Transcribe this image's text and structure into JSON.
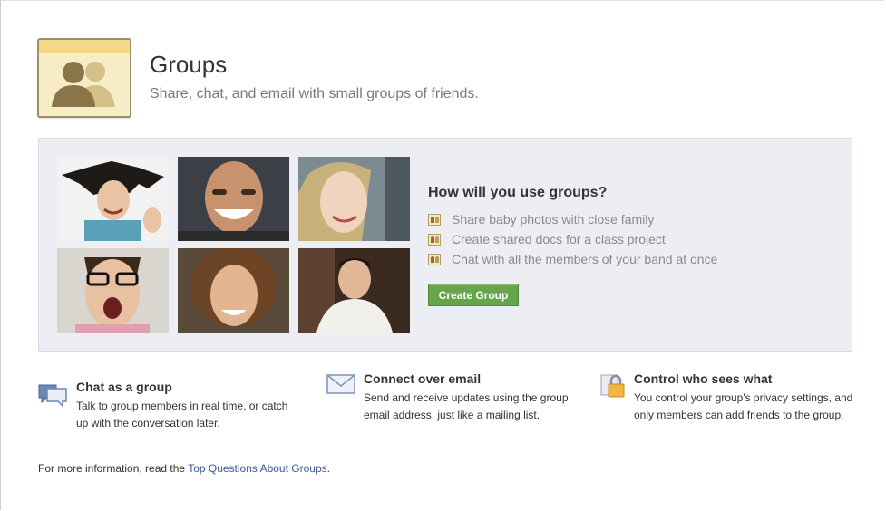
{
  "header": {
    "title": "Groups",
    "subtitle": "Share, chat, and email with small groups of friends."
  },
  "promo": {
    "question": "How will you use groups?",
    "uses": [
      "Share baby photos with close family",
      "Create shared docs for a class project",
      "Chat with all the members of your band at once"
    ],
    "create_button": "Create Group",
    "photos": [
      {
        "icon": "person-photo-woman-hair-flying"
      },
      {
        "icon": "person-photo-smiling-man"
      },
      {
        "icon": "person-photo-blonde-woman"
      },
      {
        "icon": "person-photo-man-glasses"
      },
      {
        "icon": "person-photo-curly-hair-man"
      },
      {
        "icon": "person-photo-man-sitting"
      }
    ]
  },
  "features": [
    {
      "icon": "speech-bubbles-icon",
      "title": "Chat as a group",
      "desc": "Talk to group members in real time, or catch up with the conversation later."
    },
    {
      "icon": "envelope-icon",
      "title": "Connect over email",
      "desc": "Send and receive updates using the group email address, just like a mailing list."
    },
    {
      "icon": "padlock-icon",
      "title": "Control who sees what",
      "desc": "You control your group's privacy settings, and only members can add friends to the group."
    }
  ],
  "footer": {
    "prefix": "For more information, read the ",
    "link": "Top Questions About Groups",
    "suffix": "."
  },
  "colors": {
    "button_green": "#67a54b",
    "link_blue": "#3b5998",
    "promo_bg": "#eceef3"
  }
}
